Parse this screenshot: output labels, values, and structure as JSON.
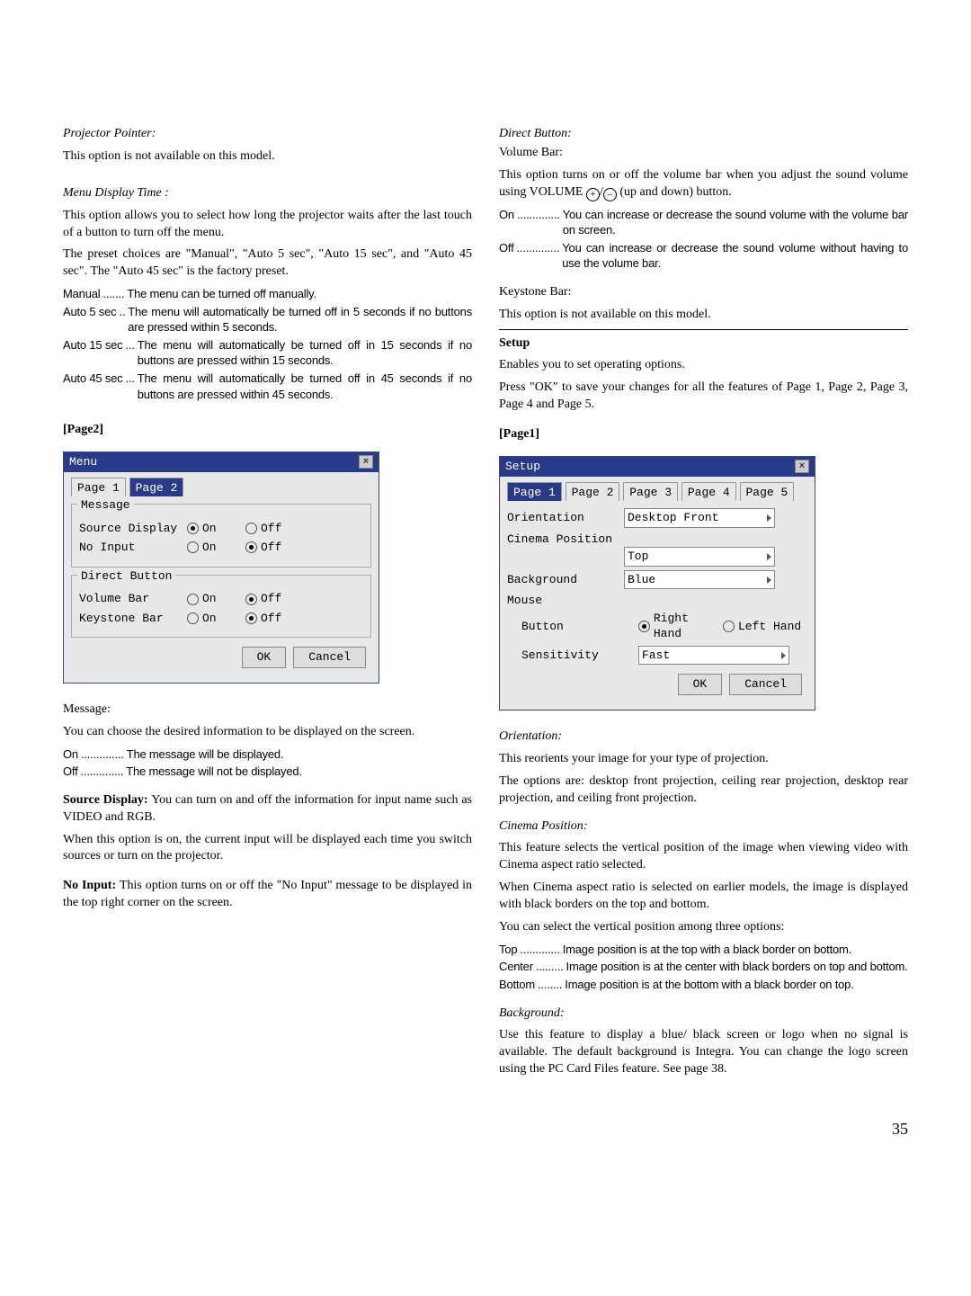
{
  "left": {
    "projector_pointer_hd": "Projector Pointer:",
    "projector_pointer_body": "This option is not available on this model.",
    "menu_display_time_hd": "Menu Display Time :",
    "mdt_body1": "This option allows you to select how long the projector waits after the last touch of a button to turn off the menu.",
    "mdt_body2": "The preset choices are \"Manual\", \"Auto 5 sec\", \"Auto 15 sec\", and \"Auto 45 sec\". The \"Auto 45 sec\" is the factory preset.",
    "mdt_rows": [
      {
        "k": "Manual",
        "d": ".......",
        "v": "The menu can be turned off manually."
      },
      {
        "k": "Auto 5 sec",
        "d": "..",
        "v": "The menu will automatically be turned off in 5 seconds if no buttons are pressed within 5 seconds."
      },
      {
        "k": "Auto 15 sec",
        "d": "...",
        "v": "The menu will automatically be turned off in 15 seconds if no buttons are pressed within 15 seconds."
      },
      {
        "k": "Auto 45 sec",
        "d": "...",
        "v": "The menu will automatically be turned off in 45 seconds if no buttons are pressed within 45 seconds."
      }
    ],
    "page2_hd": "[Page2]",
    "menu_win": {
      "title": "Menu",
      "tabs": [
        "Page 1",
        "Page 2"
      ],
      "active_tab": 1,
      "group1": {
        "label": "Message",
        "rows": [
          {
            "label": "Source Display",
            "on": true
          },
          {
            "label": "No Input",
            "on": false
          }
        ],
        "on": "On",
        "off": "Off"
      },
      "group2": {
        "label": "Direct Button",
        "rows": [
          {
            "label": "Volume Bar",
            "on": false
          },
          {
            "label": "Keystone Bar",
            "on": false
          }
        ],
        "on": "On",
        "off": "Off"
      },
      "ok": "OK",
      "cancel": "Cancel"
    },
    "message_hd": "Message:",
    "message_body": "You can choose the desired information to be displayed on the screen.",
    "message_rows": [
      {
        "k": "On",
        "d": "..............",
        "v": "The message will be displayed."
      },
      {
        "k": "Off",
        "d": "..............",
        "v": "The message will not be displayed."
      }
    ],
    "source_display_hd": "Source Display: ",
    "source_display_body": "You can turn on and off the information for input name such as VIDEO and RGB.",
    "source_display_body2": "When this option is on, the current input will be displayed each time you switch sources or turn on the projector.",
    "no_input_hd": "No Input: ",
    "no_input_body": "This option turns on or off the \"No Input\" message to be displayed in the top right corner on the screen."
  },
  "right": {
    "direct_button_hd": "Direct Button:",
    "volume_bar_hd": "Volume Bar:",
    "volume_bar_pre": "This option turns on or off the volume bar when you adjust the sound volume using VOLUME ",
    "plus": "+",
    "slash": "/",
    "minus": "–",
    "volume_bar_post": " (up and down) button.",
    "vb_rows": [
      {
        "k": "On",
        "d": "..............",
        "v": "You can increase or decrease the sound volume with the volume bar on screen."
      },
      {
        "k": "Off",
        "d": "..............",
        "v": "You can increase or decrease the sound volume without having to use the volume bar."
      }
    ],
    "keystone_bar_hd": "Keystone Bar:",
    "keystone_bar_body": "This option is not available on this model.",
    "setup_hd": "Setup",
    "setup_body1": "Enables you to set operating options.",
    "setup_body2": "Press \"OK\" to save your changes for all the features of Page 1, Page 2, Page 3, Page 4 and Page 5.",
    "page1_hd": "[Page1]",
    "setup_win": {
      "title": "Setup",
      "tabs": [
        "Page 1",
        "Page 2",
        "Page 3",
        "Page 4",
        "Page 5"
      ],
      "active_tab": 0,
      "orientation_label": "Orientation",
      "orientation_value": "Desktop Front",
      "cinema_label": "Cinema Position",
      "cinema_value": "Top",
      "background_label": "Background",
      "background_value": "Blue",
      "mouse_label": "Mouse",
      "button_label": "Button",
      "button_right": "Right Hand",
      "button_left": "Left Hand",
      "sensitivity_label": "Sensitivity",
      "sensitivity_value": "Fast",
      "ok": "OK",
      "cancel": "Cancel"
    },
    "orientation_hd": "Orientation:",
    "orientation_body1": "This reorients your image for your type of projection.",
    "orientation_body2": "The options are: desktop front projection, ceiling rear projection, desktop rear projection, and ceiling front projection.",
    "cinema_hd": "Cinema Position:",
    "cinema_body1": "This feature selects the vertical position of the image when viewing video with Cinema aspect ratio selected.",
    "cinema_body2": "When Cinema aspect ratio is selected on earlier models, the image is displayed with black borders on the top and bottom.",
    "cinema_body3": "You can select the vertical position among three options:",
    "cinema_rows": [
      {
        "k": "Top",
        "d": ".............",
        "v": "Image position is at the top with a black border on bottom."
      },
      {
        "k": "Center",
        "d": ".........",
        "v": "Image position is at the center with black borders on top and bottom."
      },
      {
        "k": "Bottom",
        "d": "........",
        "v": "Image position is at the bottom with a black border on top."
      }
    ],
    "background_hd": "Background:",
    "background_body": "Use this feature to display a blue/ black screen or logo when no signal is available. The default background is Integra. You can change the logo screen using the PC Card Files feature. See page 38."
  },
  "page_number": "35"
}
